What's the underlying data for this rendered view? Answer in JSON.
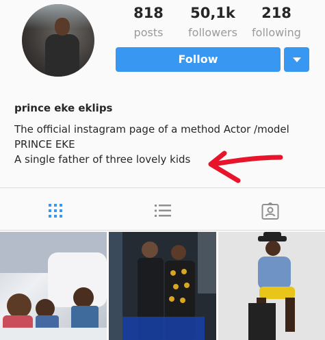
{
  "profile": {
    "avatar_icon": "profile-photo",
    "stats": [
      {
        "value": "818",
        "label": "posts"
      },
      {
        "value": "50,1k",
        "label": "followers"
      },
      {
        "value": "218",
        "label": "following"
      }
    ],
    "follow_label": "Follow",
    "dropdown_icon": "caret-down-icon",
    "accent_color": "#3897f0"
  },
  "bio": {
    "name": "prince eke eklips",
    "lines": [
      "The official instagram page of a method Actor /model",
      "PRINCE EKE",
      "A single father of three lovely kids"
    ],
    "annotation_color": "#e8142c"
  },
  "tabs": [
    {
      "icon": "grid-icon",
      "active": true
    },
    {
      "icon": "list-icon",
      "active": false
    },
    {
      "icon": "tagged-photo-icon",
      "active": false
    }
  ],
  "photos": [
    {
      "icon": "post-thumbnail"
    },
    {
      "icon": "post-thumbnail"
    },
    {
      "icon": "post-thumbnail"
    }
  ]
}
